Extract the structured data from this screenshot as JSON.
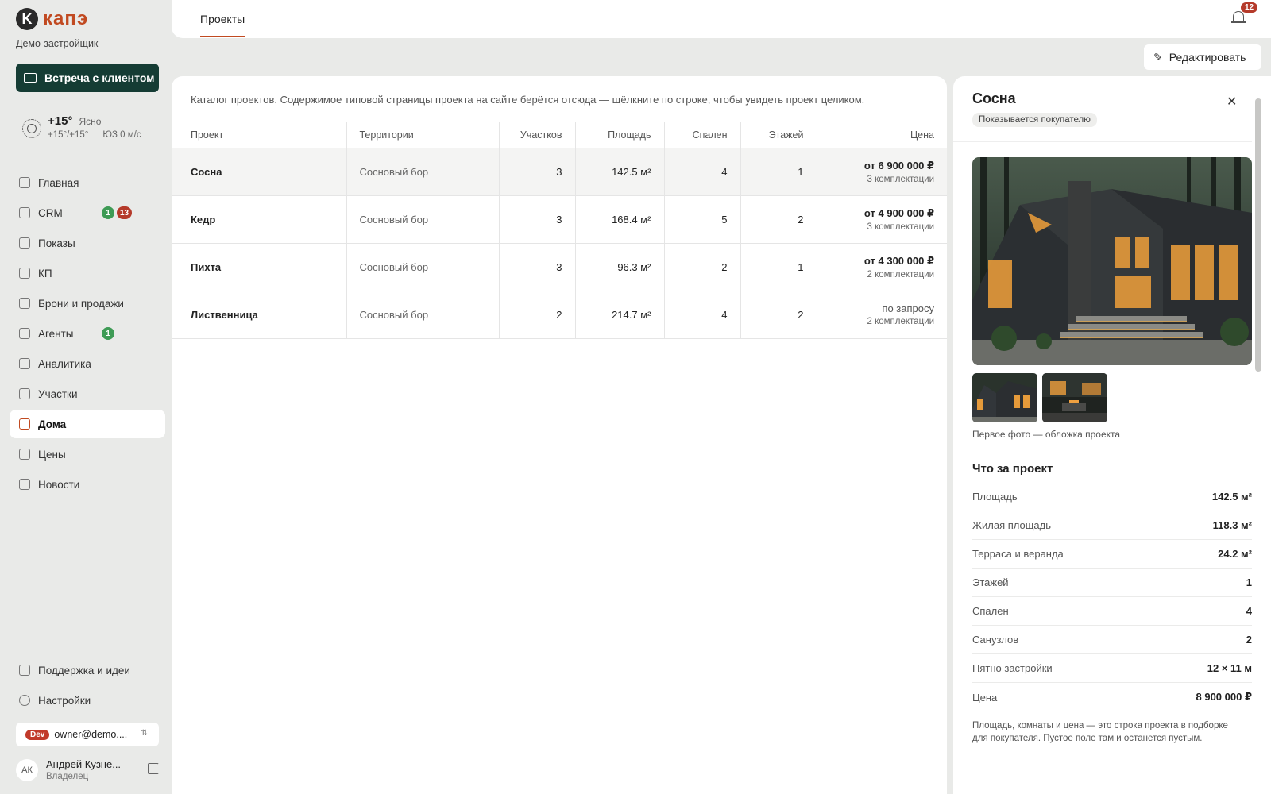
{
  "brand": {
    "mark": "K",
    "name": "капэ",
    "company": "Демо-застройщик",
    "accent": "#c14a21"
  },
  "meeting_button": {
    "label": "Встреча с клиентом"
  },
  "weather": {
    "temp": "+15°",
    "condition": "Ясно",
    "range": "+15°/+15°",
    "wind": "ЮЗ 0 м/с"
  },
  "nav": [
    {
      "label": "Главная",
      "icon": "grid-icon"
    },
    {
      "label": "CRM",
      "icon": "user-card-icon",
      "badge_green": "1",
      "badge_red": "13"
    },
    {
      "label": "Показы",
      "icon": "monitor-icon"
    },
    {
      "label": "КП",
      "icon": "document-icon"
    },
    {
      "label": "Брони и продажи",
      "icon": "handshake-icon"
    },
    {
      "label": "Агенты",
      "icon": "building-icon",
      "badge_green": "1"
    },
    {
      "label": "Аналитика",
      "icon": "bar-chart-icon"
    },
    {
      "label": "Участки",
      "icon": "plot-icon"
    },
    {
      "label": "Дома",
      "icon": "house-icon",
      "active": true
    },
    {
      "label": "Цены",
      "icon": "price-tag-icon"
    },
    {
      "label": "Новости",
      "icon": "megaphone-icon"
    }
  ],
  "nav_bottom": [
    {
      "label": "Поддержка и идеи",
      "icon": "chat-icon"
    },
    {
      "label": "Настройки",
      "icon": "gear-icon"
    }
  ],
  "account": {
    "env": "Dev",
    "email": "owner@demo...."
  },
  "user": {
    "initials": "АК",
    "name": "Андрей Кузне...",
    "role": "Владелец"
  },
  "topbar": {
    "tab": "Проекты",
    "notifications": "12"
  },
  "edit_button": {
    "label": "Редактировать"
  },
  "catalog": {
    "description": "Каталог проектов. Содержимое типовой страницы проекта на сайте берётся отсюда — щёлкните по строке, чтобы увидеть проект целиком.",
    "columns": [
      "Проект",
      "Территории",
      "Участков",
      "Площадь",
      "Спален",
      "Этажей",
      "Цена"
    ],
    "rows": [
      {
        "name": "Сосна",
        "territory": "Сосновый бор",
        "plots": "3",
        "area": "142.5 м²",
        "bedrooms": "4",
        "floors": "1",
        "price": "от 6 900 000 ₽",
        "configs": "3 комплектации",
        "selected": true
      },
      {
        "name": "Кедр",
        "territory": "Сосновый бор",
        "plots": "3",
        "area": "168.4 м²",
        "bedrooms": "5",
        "floors": "2",
        "price": "от 4 900 000 ₽",
        "configs": "3 комплектации"
      },
      {
        "name": "Пихта",
        "territory": "Сосновый бор",
        "plots": "3",
        "area": "96.3 м²",
        "bedrooms": "2",
        "floors": "1",
        "price": "от 4 300 000 ₽",
        "configs": "2 комплектации"
      },
      {
        "name": "Лиственница",
        "territory": "Сосновый бор",
        "plots": "2",
        "area": "214.7 м²",
        "bedrooms": "4",
        "floors": "2",
        "price": "по запросу",
        "configs": "2 комплектации",
        "price_plain": true
      }
    ]
  },
  "detail": {
    "title": "Сосна",
    "tag": "Показывается покупателю",
    "cover_note": "Первое фото — обложка проекта",
    "section_title": "Что за проект",
    "specs": [
      {
        "label": "Площадь",
        "value": "142.5 м²"
      },
      {
        "label": "Жилая площадь",
        "value": "118.3 м²"
      },
      {
        "label": "Терраса и веранда",
        "value": "24.2 м²"
      },
      {
        "label": "Этажей",
        "value": "1"
      },
      {
        "label": "Спален",
        "value": "4"
      },
      {
        "label": "Санузлов",
        "value": "2"
      },
      {
        "label": "Пятно застройки",
        "value": "12 × 11 м"
      },
      {
        "label": "Цена",
        "value": "8 900 000 ₽"
      }
    ],
    "note": "Площадь, комнаты и цена — это строка проекта в подборке для покупателя. Пустое поле там и останется пустым."
  }
}
